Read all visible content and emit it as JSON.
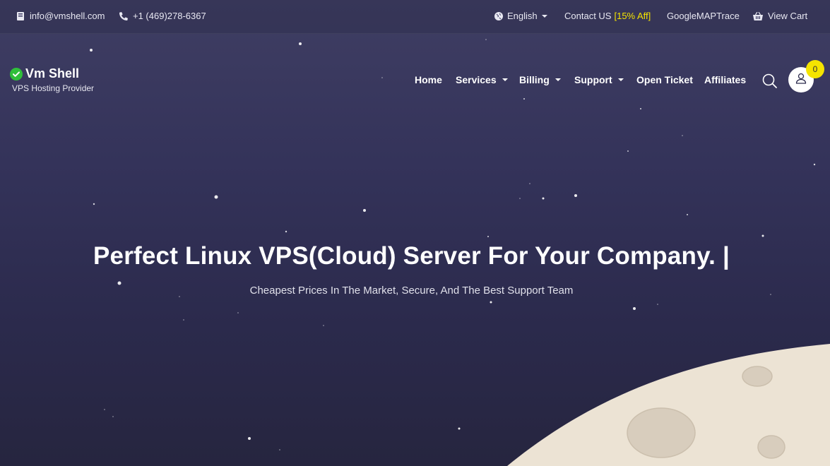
{
  "topbar": {
    "email": "info@vmshell.com",
    "phone": "+1 (469)278-6367",
    "language": "English",
    "contact_label": "Contact US",
    "contact_aff": "[15% Aff]",
    "trace": "GoogleMAPTrace",
    "cart": "View Cart",
    "icons": [
      "book-icon",
      "phone-icon",
      "globe-icon",
      "basket-icon"
    ]
  },
  "brand": {
    "name": "Vm Shell",
    "tagline": "VPS Hosting Provider"
  },
  "nav": {
    "home": "Home",
    "services": "Services",
    "billing": "Billing",
    "support": "Support",
    "open_ticket": "Open Ticket",
    "affiliates": "Affiliates"
  },
  "cart_count": "0",
  "hero": {
    "title": "Perfect Linux VPS(Cloud) Server For Your Company. |",
    "subtitle": "Cheapest Prices In The Market, Secure, And The Best Support Team"
  },
  "colors": {
    "accent_yellow": "#f5e400",
    "check_green": "#2fbf3a",
    "background_top": "#3f3e63",
    "background_bottom": "#26253f",
    "moon": "#ece3d4"
  }
}
